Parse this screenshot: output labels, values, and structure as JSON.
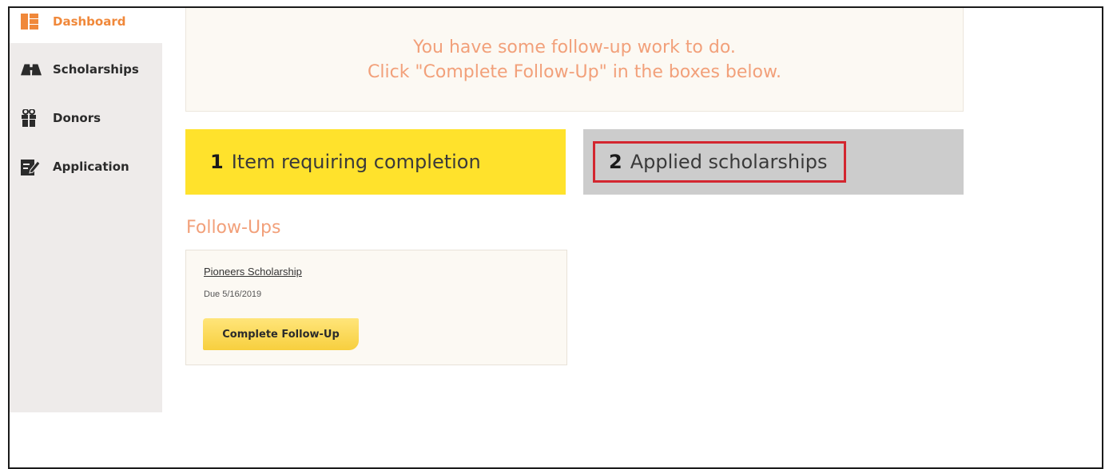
{
  "sidebar": {
    "items": [
      {
        "label": "Dashboard",
        "icon": "dashboard-icon",
        "active": true
      },
      {
        "label": "Scholarships",
        "icon": "books-icon",
        "active": false
      },
      {
        "label": "Donors",
        "icon": "gift-icon",
        "active": false
      },
      {
        "label": "Application",
        "icon": "edit-document-icon",
        "active": false
      }
    ]
  },
  "banner": {
    "line1": "You have some follow-up work to do.",
    "line2": "Click \"Complete Follow-Up\" in the boxes below."
  },
  "summary": {
    "completion": {
      "count": "1",
      "label": "Item requiring completion"
    },
    "applied": {
      "count": "2",
      "label": "Applied scholarships"
    }
  },
  "followups": {
    "heading": "Follow-Ups",
    "items": [
      {
        "title": "Pioneers Scholarship",
        "due": "Due 5/16/2019",
        "button": "Complete Follow-Up"
      }
    ]
  },
  "colors": {
    "accent": "#f0883a",
    "banner_text": "#f2a07a",
    "completion_card": "#ffe22c",
    "applied_card": "#cccccc",
    "highlight": "#d3262f"
  }
}
